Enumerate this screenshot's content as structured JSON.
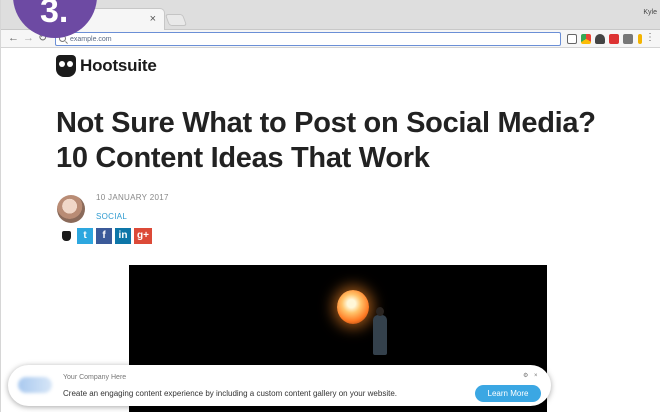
{
  "browser": {
    "tab_close": "×",
    "user_name": "Kyle",
    "url": "example.com",
    "menu": "⋮"
  },
  "badge": {
    "label": "3."
  },
  "page": {
    "logo_text": "Hootsuite",
    "title": "Not Sure What to Post on Social Media? 10 Content Ideas That Work",
    "date": "10 JANUARY 2017",
    "category": "SOCIAL",
    "share": {
      "twitter": "t",
      "facebook": "f",
      "linkedin": "in",
      "google": "g+"
    }
  },
  "notification": {
    "company": "Your Company Here",
    "message": "Create an engaging content experience by including a custom content gallery on your website.",
    "button": "Learn More",
    "icons": "⚙ ×"
  },
  "colors": {
    "badge": "#6d4aa3",
    "accent": "#2f9bd0",
    "learn_button": "#3ba7e3"
  }
}
